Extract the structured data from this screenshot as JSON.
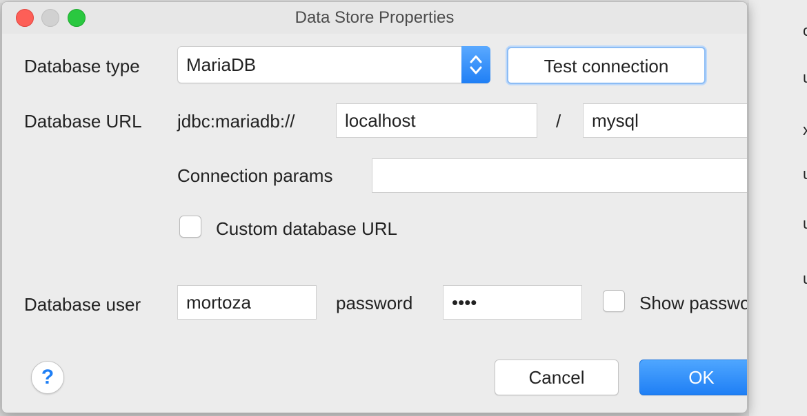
{
  "window": {
    "title": "Data Store Properties"
  },
  "database_type": {
    "label": "Database type",
    "selected": "MariaDB"
  },
  "test_connection_label": "Test connection",
  "database_url": {
    "label": "Database URL",
    "prefix": "jdbc:mariadb://",
    "host": "localhost",
    "separator": "/",
    "database": "mysql"
  },
  "connection_params": {
    "label": "Connection params",
    "value": ""
  },
  "custom_url": {
    "label": "Custom database URL",
    "checked": false
  },
  "database_user": {
    "label": "Database user",
    "value": "mortoza"
  },
  "password": {
    "label": "password",
    "value": "••••"
  },
  "show_password": {
    "label": "Show password",
    "checked": false
  },
  "buttons": {
    "cancel": "Cancel",
    "ok": "OK",
    "help": "?"
  },
  "colors": {
    "accent": "#1f7ff5",
    "close": "#fd5f57",
    "maximize": "#2ac840"
  }
}
